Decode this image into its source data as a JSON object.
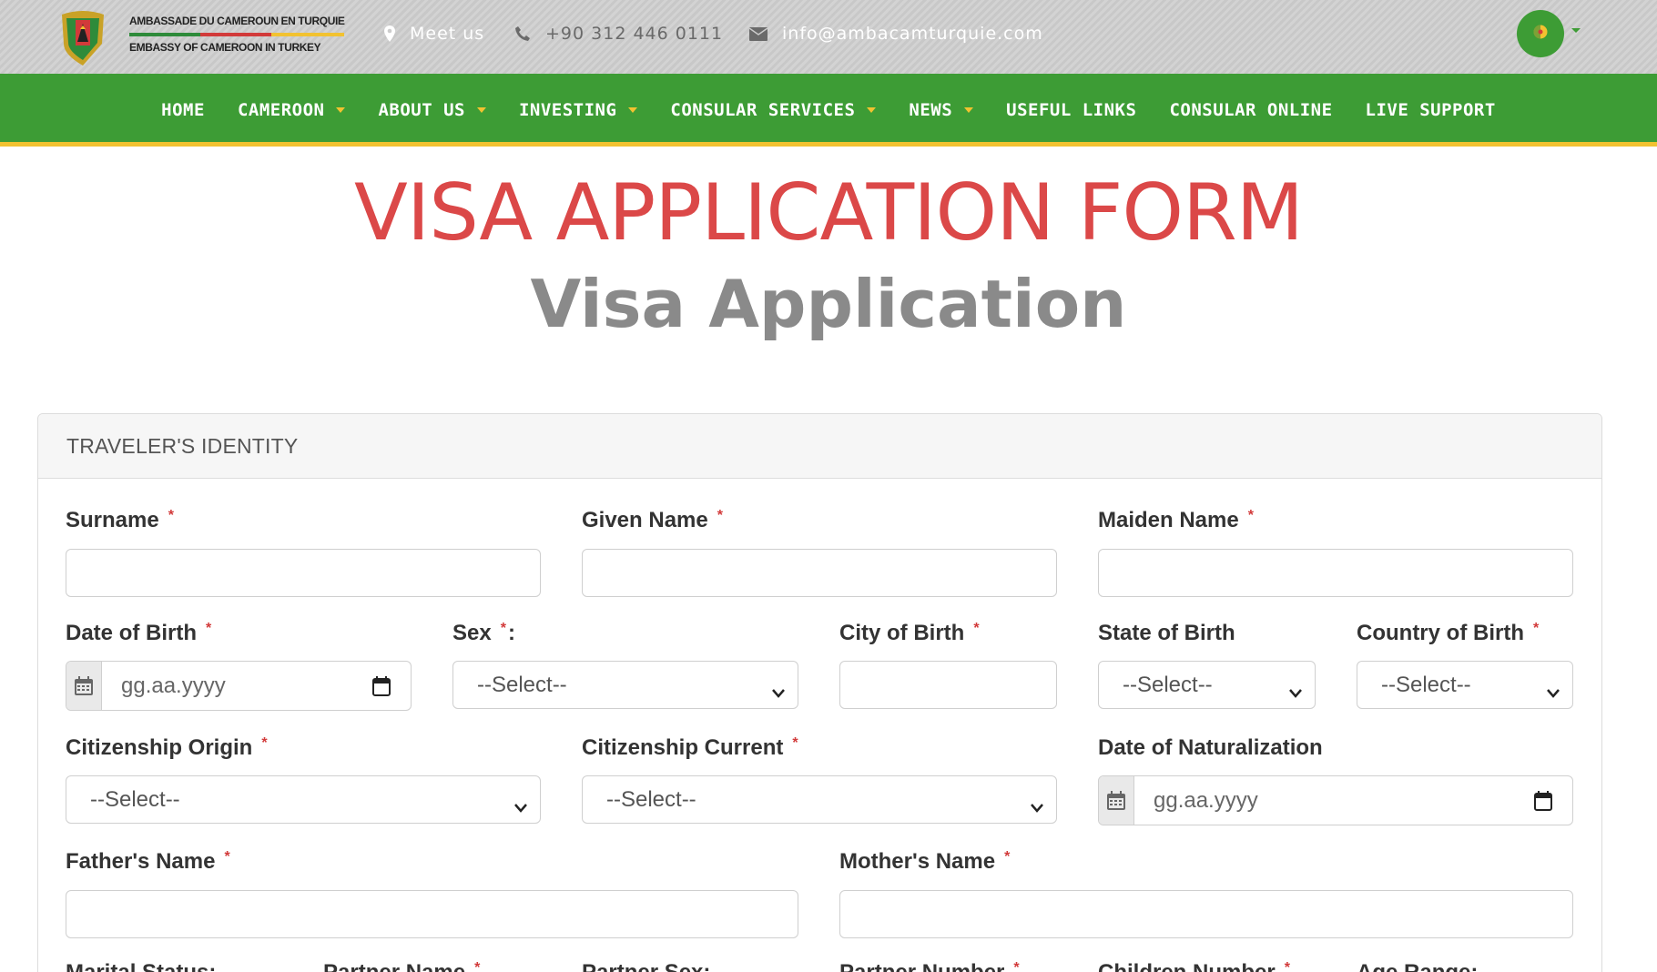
{
  "header": {
    "logo_line1": "AMBASSADE DU CAMEROUN EN TURQUIE",
    "logo_line2": "EMBASSY OF CAMEROON IN TURKEY",
    "meet_label": "Meet us",
    "phone": "+90 312 446 0111",
    "email": "info@ambacamturquie.com",
    "language_icon": "cameroon-flag-icon"
  },
  "nav": {
    "items": [
      {
        "label": "HOME",
        "dropdown": false
      },
      {
        "label": "CAMEROON",
        "dropdown": true
      },
      {
        "label": "ABOUT US",
        "dropdown": true
      },
      {
        "label": "INVESTING",
        "dropdown": true
      },
      {
        "label": "CONSULAR SERVICES",
        "dropdown": true
      },
      {
        "label": "NEWS",
        "dropdown": true
      },
      {
        "label": "USEFUL LINKS",
        "dropdown": false
      },
      {
        "label": "CONSULAR ONLINE",
        "dropdown": false
      },
      {
        "label": "LIVE SUPPORT",
        "dropdown": false
      }
    ]
  },
  "page": {
    "title": "VISA APPLICATION FORM",
    "subtitle": "Visa Application"
  },
  "form": {
    "section_title": "TRAVELER'S IDENTITY",
    "required_mark": "*",
    "surname_label": "Surname",
    "given_name_label": "Given Name",
    "maiden_name_label": "Maiden Name",
    "dob_label": "Date of Birth",
    "dob_placeholder": "gg.aa.yyyy",
    "sex_label": "Sex",
    "sex_value": "--Select--",
    "city_of_birth_label": "City of Birth",
    "state_of_birth_label": "State of Birth",
    "state_of_birth_value": "--Select--",
    "country_of_birth_label": "Country of Birth",
    "country_of_birth_value": "--Select--",
    "citizenship_origin_label": "Citizenship Origin",
    "citizenship_origin_value": "--Select--",
    "citizenship_current_label": "Citizenship Current",
    "citizenship_current_value": "--Select--",
    "naturalization_label": "Date of Naturalization",
    "naturalization_placeholder": "gg.aa.yyyy",
    "father_name_label": "Father's Name",
    "mother_name_label": "Mother's Name",
    "cut_row": {
      "marital_status": "Marital Status:",
      "partner_name": "Partner Name",
      "partner_sex": "Partner Sex:",
      "partner_number": "Partner Number",
      "children_number": "Children Number",
      "age_range": "Age Range:"
    }
  },
  "colors": {
    "nav_green": "#3d9c35",
    "accent_yellow": "#f2c230",
    "title_red": "#db4848",
    "required_red": "#d23a3a"
  }
}
